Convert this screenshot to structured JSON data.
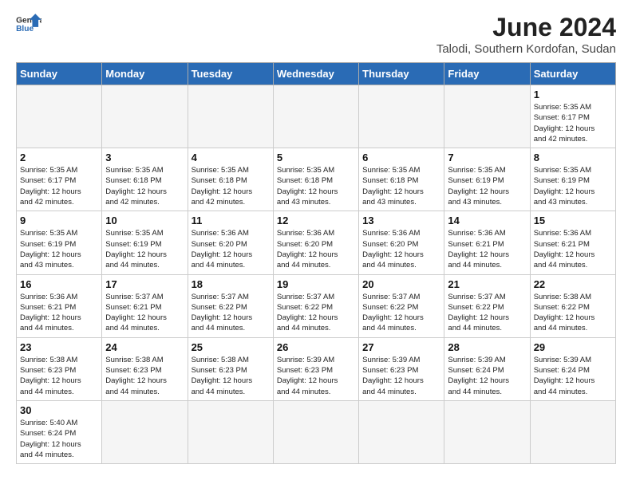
{
  "logo": {
    "text_general": "General",
    "text_blue": "Blue"
  },
  "title": "June 2024",
  "subtitle": "Talodi, Southern Kordofan, Sudan",
  "days_of_week": [
    "Sunday",
    "Monday",
    "Tuesday",
    "Wednesday",
    "Thursday",
    "Friday",
    "Saturday"
  ],
  "weeks": [
    [
      {
        "day": "",
        "info": ""
      },
      {
        "day": "",
        "info": ""
      },
      {
        "day": "",
        "info": ""
      },
      {
        "day": "",
        "info": ""
      },
      {
        "day": "",
        "info": ""
      },
      {
        "day": "",
        "info": ""
      },
      {
        "day": "1",
        "info": "Sunrise: 5:35 AM\nSunset: 6:17 PM\nDaylight: 12 hours\nand 42 minutes."
      }
    ],
    [
      {
        "day": "2",
        "info": "Sunrise: 5:35 AM\nSunset: 6:17 PM\nDaylight: 12 hours\nand 42 minutes."
      },
      {
        "day": "3",
        "info": "Sunrise: 5:35 AM\nSunset: 6:18 PM\nDaylight: 12 hours\nand 42 minutes."
      },
      {
        "day": "4",
        "info": "Sunrise: 5:35 AM\nSunset: 6:18 PM\nDaylight: 12 hours\nand 42 minutes."
      },
      {
        "day": "5",
        "info": "Sunrise: 5:35 AM\nSunset: 6:18 PM\nDaylight: 12 hours\nand 43 minutes."
      },
      {
        "day": "6",
        "info": "Sunrise: 5:35 AM\nSunset: 6:18 PM\nDaylight: 12 hours\nand 43 minutes."
      },
      {
        "day": "7",
        "info": "Sunrise: 5:35 AM\nSunset: 6:19 PM\nDaylight: 12 hours\nand 43 minutes."
      },
      {
        "day": "8",
        "info": "Sunrise: 5:35 AM\nSunset: 6:19 PM\nDaylight: 12 hours\nand 43 minutes."
      }
    ],
    [
      {
        "day": "9",
        "info": "Sunrise: 5:35 AM\nSunset: 6:19 PM\nDaylight: 12 hours\nand 43 minutes."
      },
      {
        "day": "10",
        "info": "Sunrise: 5:35 AM\nSunset: 6:19 PM\nDaylight: 12 hours\nand 44 minutes."
      },
      {
        "day": "11",
        "info": "Sunrise: 5:36 AM\nSunset: 6:20 PM\nDaylight: 12 hours\nand 44 minutes."
      },
      {
        "day": "12",
        "info": "Sunrise: 5:36 AM\nSunset: 6:20 PM\nDaylight: 12 hours\nand 44 minutes."
      },
      {
        "day": "13",
        "info": "Sunrise: 5:36 AM\nSunset: 6:20 PM\nDaylight: 12 hours\nand 44 minutes."
      },
      {
        "day": "14",
        "info": "Sunrise: 5:36 AM\nSunset: 6:21 PM\nDaylight: 12 hours\nand 44 minutes."
      },
      {
        "day": "15",
        "info": "Sunrise: 5:36 AM\nSunset: 6:21 PM\nDaylight: 12 hours\nand 44 minutes."
      }
    ],
    [
      {
        "day": "16",
        "info": "Sunrise: 5:36 AM\nSunset: 6:21 PM\nDaylight: 12 hours\nand 44 minutes."
      },
      {
        "day": "17",
        "info": "Sunrise: 5:37 AM\nSunset: 6:21 PM\nDaylight: 12 hours\nand 44 minutes."
      },
      {
        "day": "18",
        "info": "Sunrise: 5:37 AM\nSunset: 6:22 PM\nDaylight: 12 hours\nand 44 minutes."
      },
      {
        "day": "19",
        "info": "Sunrise: 5:37 AM\nSunset: 6:22 PM\nDaylight: 12 hours\nand 44 minutes."
      },
      {
        "day": "20",
        "info": "Sunrise: 5:37 AM\nSunset: 6:22 PM\nDaylight: 12 hours\nand 44 minutes."
      },
      {
        "day": "21",
        "info": "Sunrise: 5:37 AM\nSunset: 6:22 PM\nDaylight: 12 hours\nand 44 minutes."
      },
      {
        "day": "22",
        "info": "Sunrise: 5:38 AM\nSunset: 6:22 PM\nDaylight: 12 hours\nand 44 minutes."
      }
    ],
    [
      {
        "day": "23",
        "info": "Sunrise: 5:38 AM\nSunset: 6:23 PM\nDaylight: 12 hours\nand 44 minutes."
      },
      {
        "day": "24",
        "info": "Sunrise: 5:38 AM\nSunset: 6:23 PM\nDaylight: 12 hours\nand 44 minutes."
      },
      {
        "day": "25",
        "info": "Sunrise: 5:38 AM\nSunset: 6:23 PM\nDaylight: 12 hours\nand 44 minutes."
      },
      {
        "day": "26",
        "info": "Sunrise: 5:39 AM\nSunset: 6:23 PM\nDaylight: 12 hours\nand 44 minutes."
      },
      {
        "day": "27",
        "info": "Sunrise: 5:39 AM\nSunset: 6:23 PM\nDaylight: 12 hours\nand 44 minutes."
      },
      {
        "day": "28",
        "info": "Sunrise: 5:39 AM\nSunset: 6:24 PM\nDaylight: 12 hours\nand 44 minutes."
      },
      {
        "day": "29",
        "info": "Sunrise: 5:39 AM\nSunset: 6:24 PM\nDaylight: 12 hours\nand 44 minutes."
      }
    ],
    [
      {
        "day": "30",
        "info": "Sunrise: 5:40 AM\nSunset: 6:24 PM\nDaylight: 12 hours\nand 44 minutes."
      },
      {
        "day": "",
        "info": ""
      },
      {
        "day": "",
        "info": ""
      },
      {
        "day": "",
        "info": ""
      },
      {
        "day": "",
        "info": ""
      },
      {
        "day": "",
        "info": ""
      },
      {
        "day": "",
        "info": ""
      }
    ]
  ]
}
